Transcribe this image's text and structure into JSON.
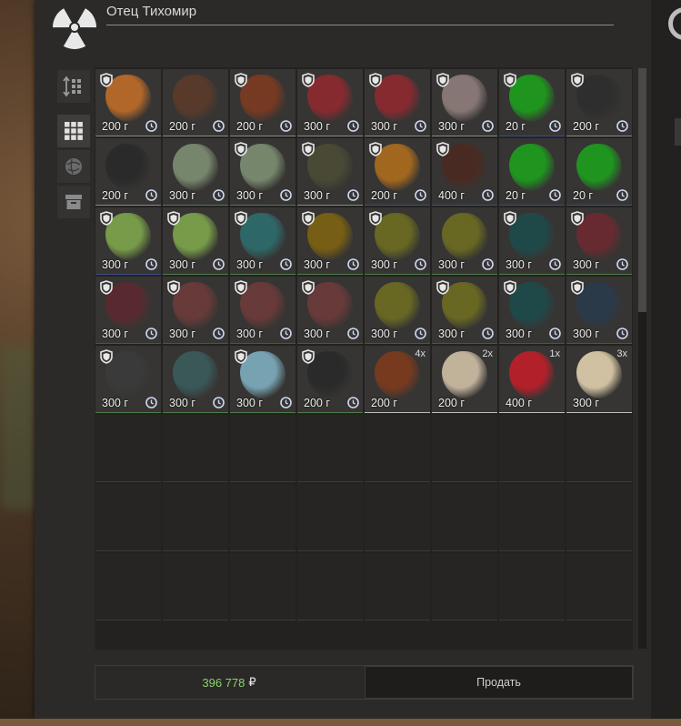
{
  "trader": {
    "name": "Отец Тихомир"
  },
  "side_buttons": [
    {
      "icon": "sort-icon",
      "active": false
    },
    {
      "icon": "grid-icon",
      "active": true
    },
    {
      "icon": "artifact-icon",
      "active": false
    },
    {
      "icon": "box-icon",
      "active": false
    }
  ],
  "grid": {
    "columns": 8,
    "rows": 8
  },
  "items": [
    {
      "weight": "200 г",
      "shield": true,
      "clock": true,
      "color": "#b86a2a",
      "rarity": "grey"
    },
    {
      "weight": "200 г",
      "shield": false,
      "clock": true,
      "color": "#5a3a2a",
      "rarity": "grey"
    },
    {
      "weight": "200 г",
      "shield": true,
      "clock": true,
      "color": "#7a3a22",
      "rarity": "grey"
    },
    {
      "weight": "300 г",
      "shield": true,
      "clock": true,
      "color": "#8a2a30",
      "rarity": "grey"
    },
    {
      "weight": "300 г",
      "shield": true,
      "clock": true,
      "color": "#8a2a30",
      "rarity": "grey"
    },
    {
      "weight": "300 г",
      "shield": true,
      "clock": true,
      "color": "#8a7a78",
      "rarity": "grey"
    },
    {
      "weight": "20 г",
      "shield": true,
      "clock": true,
      "color": "#1e9a1e",
      "rarity": "blue"
    },
    {
      "weight": "200 г",
      "shield": true,
      "clock": true,
      "color": "#2e2e2e",
      "rarity": "grey"
    },
    {
      "weight": "200 г",
      "shield": false,
      "clock": true,
      "color": "#2a2a2a",
      "rarity": "grey"
    },
    {
      "weight": "300 г",
      "shield": false,
      "clock": true,
      "color": "#7a8a70",
      "rarity": "green"
    },
    {
      "weight": "300 г",
      "shield": true,
      "clock": true,
      "color": "#7a8a70",
      "rarity": "green"
    },
    {
      "weight": "300 г",
      "shield": true,
      "clock": true,
      "color": "#4a4a36",
      "rarity": "grey"
    },
    {
      "weight": "200 г",
      "shield": true,
      "clock": true,
      "color": "#a86a1e",
      "rarity": "blue"
    },
    {
      "weight": "400 г",
      "shield": true,
      "clock": true,
      "color": "#4a2a22",
      "rarity": "blue"
    },
    {
      "weight": "20 г",
      "shield": false,
      "clock": true,
      "color": "#1e9a1e",
      "rarity": "blue"
    },
    {
      "weight": "20 г",
      "shield": false,
      "clock": true,
      "color": "#1e9a1e",
      "rarity": "blue"
    },
    {
      "weight": "300 г",
      "shield": true,
      "clock": true,
      "color": "#7aa04a",
      "rarity": "blue"
    },
    {
      "weight": "300 г",
      "shield": true,
      "clock": true,
      "color": "#7aa04a",
      "rarity": "green"
    },
    {
      "weight": "300 г",
      "shield": true,
      "clock": true,
      "color": "#2e6a6a",
      "rarity": "green"
    },
    {
      "weight": "300 г",
      "shield": true,
      "clock": true,
      "color": "#7a6012",
      "rarity": "green"
    },
    {
      "weight": "300 г",
      "shield": true,
      "clock": true,
      "color": "#6a6a22",
      "rarity": "green"
    },
    {
      "weight": "300 г",
      "shield": false,
      "clock": true,
      "color": "#6a6a22",
      "rarity": "green"
    },
    {
      "weight": "300 г",
      "shield": true,
      "clock": true,
      "color": "#1e4a4a",
      "rarity": "green"
    },
    {
      "weight": "300 г",
      "shield": true,
      "clock": true,
      "color": "#6a2a30",
      "rarity": "green"
    },
    {
      "weight": "300 г",
      "shield": true,
      "clock": true,
      "color": "#5a2a30",
      "rarity": "blue"
    },
    {
      "weight": "300 г",
      "shield": true,
      "clock": true,
      "color": "#6a3a3a",
      "rarity": "blue"
    },
    {
      "weight": "300 г",
      "shield": true,
      "clock": true,
      "color": "#6a3a3a",
      "rarity": "blue"
    },
    {
      "weight": "300 г",
      "shield": true,
      "clock": true,
      "color": "#6a3a3a",
      "rarity": "blue"
    },
    {
      "weight": "300 г",
      "shield": false,
      "clock": true,
      "color": "#6a6a22",
      "rarity": "blue"
    },
    {
      "weight": "300 г",
      "shield": true,
      "clock": true,
      "color": "#6a6a22",
      "rarity": "blue"
    },
    {
      "weight": "300 г",
      "shield": true,
      "clock": true,
      "color": "#1e4a4a",
      "rarity": "blue"
    },
    {
      "weight": "300 г",
      "shield": true,
      "clock": true,
      "color": "#2a3a4a",
      "rarity": "blue"
    },
    {
      "weight": "300 г",
      "shield": true,
      "clock": true,
      "color": "#3a3a3a",
      "rarity": "green"
    },
    {
      "weight": "300 г",
      "shield": false,
      "clock": true,
      "color": "#3a5a5a",
      "rarity": "green"
    },
    {
      "weight": "300 г",
      "shield": true,
      "clock": true,
      "color": "#7aa8b8",
      "rarity": "green"
    },
    {
      "weight": "200 г",
      "shield": true,
      "clock": true,
      "color": "#2a2a2a",
      "rarity": "green"
    },
    {
      "weight": "200 г",
      "shield": false,
      "clock": false,
      "color": "#7a3a1e",
      "rarity": "white",
      "count": "4x"
    },
    {
      "weight": "200 г",
      "shield": false,
      "clock": false,
      "color": "#c8b8a0",
      "rarity": "white",
      "count": "2x"
    },
    {
      "weight": "400 г",
      "shield": false,
      "clock": false,
      "color": "#b8202a",
      "rarity": "white",
      "count": "1x"
    },
    {
      "weight": "300 г",
      "shield": false,
      "clock": false,
      "color": "#d8c8a8",
      "rarity": "white",
      "count": "3x"
    }
  ],
  "footer": {
    "money": "396 778",
    "currency": "₽",
    "sell_label": "Продать"
  }
}
